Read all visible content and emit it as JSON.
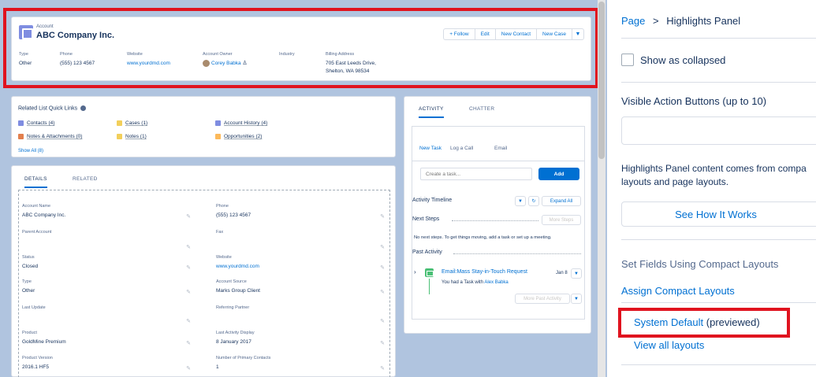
{
  "highlights": {
    "object_label": "Account",
    "record_name": "ABC Company Inc.",
    "actions": [
      "+ Follow",
      "Edit",
      "New Contact",
      "New Case"
    ],
    "fields": [
      {
        "label": "Type",
        "value": "Other"
      },
      {
        "label": "Phone",
        "value": "(555) 123 4567"
      },
      {
        "label": "Website",
        "value": "www.yourdmd.com"
      },
      {
        "label": "Account Owner",
        "value": "Corey Babka"
      },
      {
        "label": "Industry",
        "value": ""
      },
      {
        "label": "Billing Address",
        "value": "705 East Leeds Drive,",
        "value2": "Shelton, WA 98534"
      }
    ]
  },
  "quick_links": {
    "title": "Related List Quick Links",
    "items": [
      {
        "label": "Contacts (4)",
        "color": "#7f8de1"
      },
      {
        "label": "Cases (1)",
        "color": "#f2cf5b"
      },
      {
        "label": "Account History (4)",
        "color": "#7f8de1"
      },
      {
        "label": "Notes & Attachments (0)",
        "color": "#e27f4d"
      },
      {
        "label": "Notes (1)",
        "color": "#f2cf5b"
      },
      {
        "label": "Opportunities (2)",
        "color": "#fcb95b"
      }
    ],
    "show_all": "Show All (8)"
  },
  "details": {
    "tabs": [
      "DETAILS",
      "RELATED"
    ],
    "fields": [
      {
        "label": "Account Name",
        "value": "ABC Company Inc."
      },
      {
        "label": "Phone",
        "value": "(555) 123 4567"
      },
      {
        "label": "Parent Account",
        "value": ""
      },
      {
        "label": "Fax",
        "value": ""
      },
      {
        "label": "Status",
        "value": "Closed"
      },
      {
        "label": "Website",
        "value": "www.yourdmd.com"
      },
      {
        "label": "Type",
        "value": "Other"
      },
      {
        "label": "Account Source",
        "value": "Marks Group Client"
      },
      {
        "label": "Last Update",
        "value": ""
      },
      {
        "label": "Referring Partner",
        "value": ""
      },
      {
        "label": "Product",
        "value": "GoldMine Premium"
      },
      {
        "label": "Last Activity Display",
        "value": "8 January 2017"
      },
      {
        "label": "Product Version",
        "value": "2016.1 HF5"
      },
      {
        "label": "Number of Primary Contacts",
        "value": "1"
      }
    ]
  },
  "activity": {
    "tabs": [
      "ACTIVITY",
      "CHATTER"
    ],
    "subtabs": [
      "New Task",
      "Log a Call",
      "Email"
    ],
    "task_placeholder": "Create a task...",
    "add_label": "Add",
    "timeline_label": "Activity Timeline",
    "expand_all": "Expand All",
    "next_steps": "Next Steps",
    "more_steps": "More Steps",
    "no_steps": "No next steps. To get things moving, add a task or set up a meeting.",
    "past_activity": "Past Activity",
    "email_subject": "Email:Mass Stay-in-Touch Request",
    "email_date": "Jan 8",
    "email_desc": "You had a Task with",
    "email_person": "Alex Babka",
    "more_past": "More Past Activity"
  },
  "right_panel": {
    "breadcrumb_root": "Page",
    "breadcrumb_sep": ">",
    "breadcrumb_current": "Highlights Panel",
    "collapsed_label": "Show as collapsed",
    "visible_actions_label": "Visible Action Buttons (up to 10)",
    "info_line1": "Highlights Panel content comes from compa",
    "info_line2": "layouts and page layouts.",
    "see_how": "See How It Works",
    "set_fields": "Set Fields Using Compact Layouts",
    "assign": "Assign Compact Layouts",
    "system_default": "System Default",
    "previewed": "(previewed)",
    "view_all": "View all layouts"
  }
}
